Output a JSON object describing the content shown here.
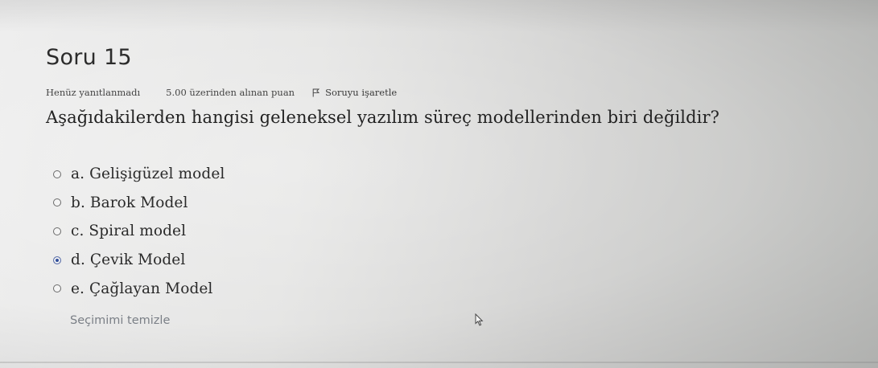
{
  "question": {
    "title": "Soru 15",
    "status": "Henüz yanıtlanmadı",
    "grade": "5.00 üzerinden alınan puan",
    "flag_label": "Soruyu işaretle",
    "text": "Aşağıdakilerden hangisi geleneksel yazılım süreç modellerinden biri değildir?",
    "answers": [
      {
        "label": "a. Gelişigüzel model",
        "selected": false
      },
      {
        "label": "b. Barok Model",
        "selected": false
      },
      {
        "label": "c. Spiral model",
        "selected": false
      },
      {
        "label": "d. Çevik Model",
        "selected": true
      },
      {
        "label": "e. Çağlayan Model",
        "selected": false
      }
    ],
    "clear_label": "Seçimimi temizle"
  },
  "colors": {
    "selected_radio": "#2f4d9a",
    "link_gray": "#7a7f86"
  },
  "icons": {
    "flag": "flag-icon",
    "cursor": "mouse-pointer-icon"
  }
}
